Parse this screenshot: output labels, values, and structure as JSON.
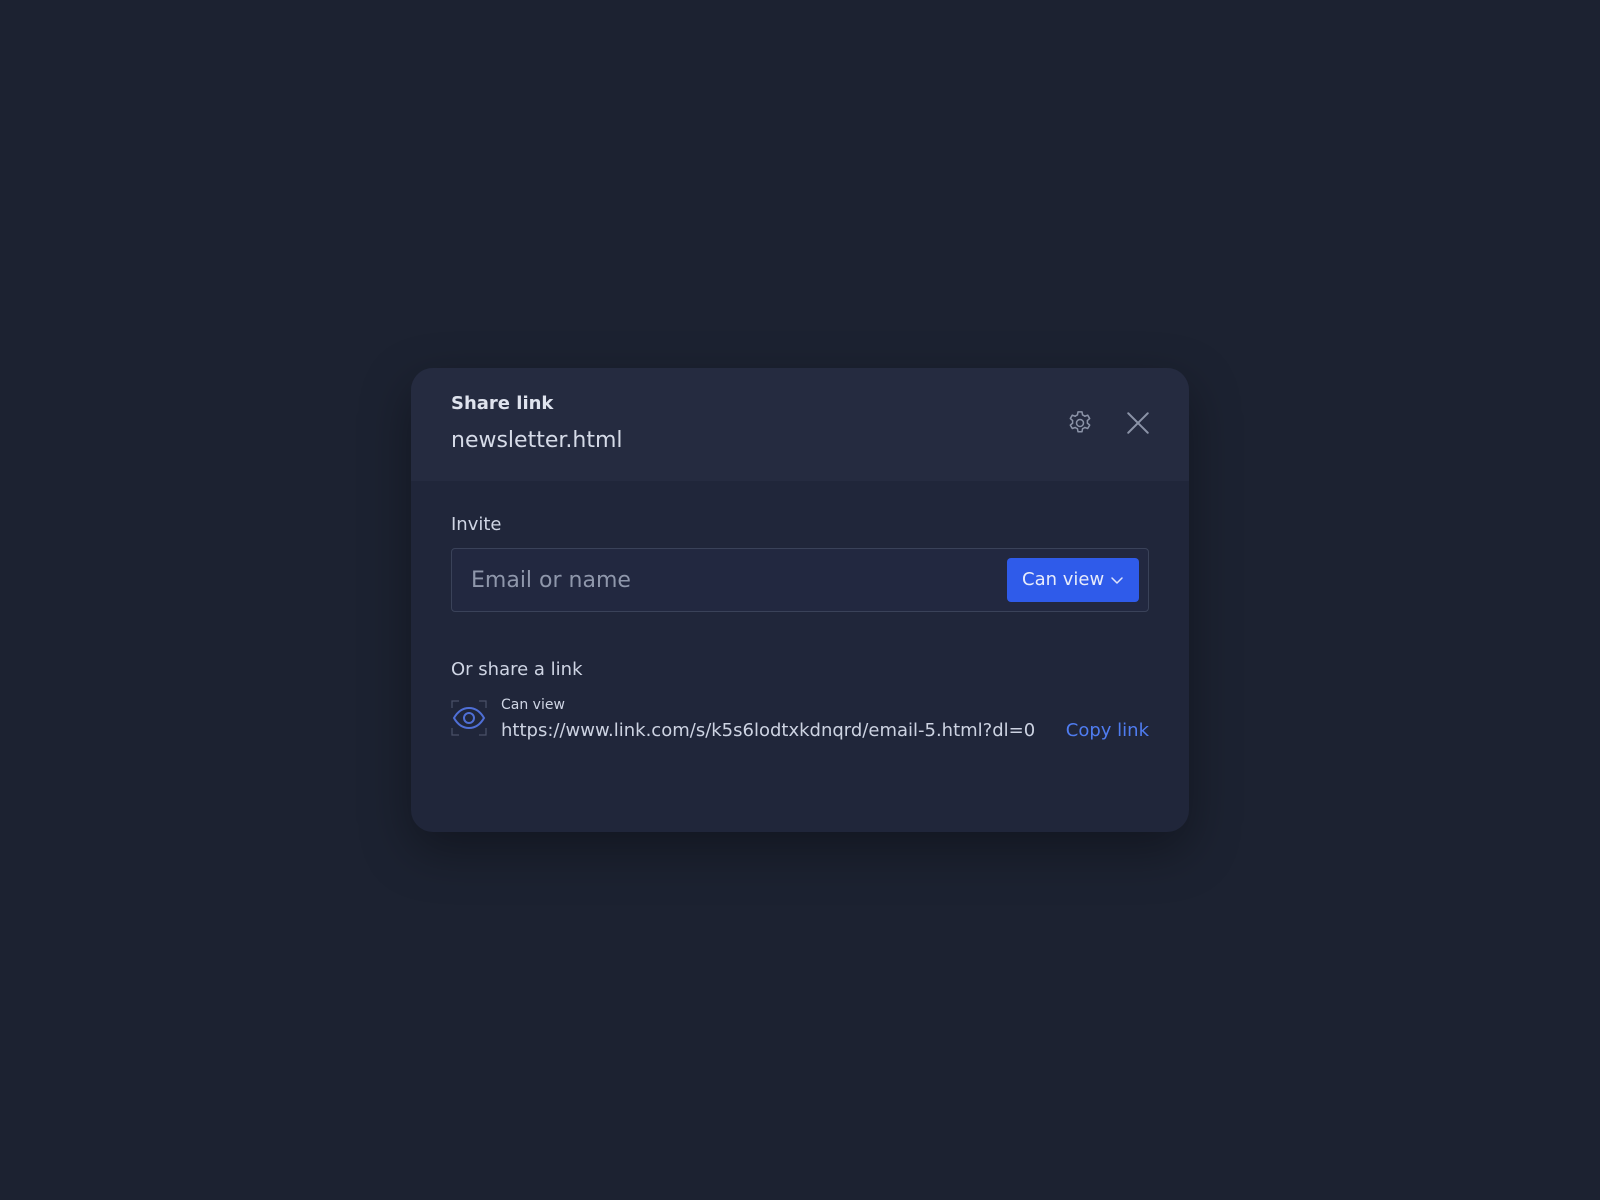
{
  "header": {
    "title": "Share link",
    "filename": "newsletter.html",
    "settings_icon": "gear-icon",
    "close_icon": "close-icon"
  },
  "invite": {
    "label": "Invite",
    "placeholder": "Email or name",
    "value": "",
    "permission": "Can view"
  },
  "share": {
    "label": "Or share a link",
    "permission": "Can view",
    "url": "https://www.link.com/s/k5s6lodtxkdnqrd/email-5.html?dl=0",
    "copy_label": "Copy link",
    "icon": "eye-icon"
  },
  "colors": {
    "background": "#1c2231",
    "modal": "#20263a",
    "header": "#252b40",
    "accent": "#2f5bea",
    "link": "#4f7cf0"
  }
}
